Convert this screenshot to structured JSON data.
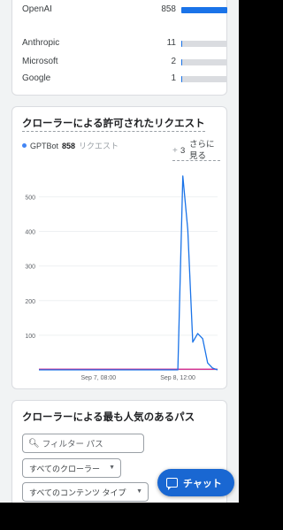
{
  "crawlers_table": {
    "rows": [
      {
        "name": "OpenAI",
        "count": "858",
        "fraction": 1.0
      },
      {
        "name": "Anthropic",
        "count": "11",
        "fraction": 0.013
      },
      {
        "name": "Microsoft",
        "count": "2",
        "fraction": 0.0
      },
      {
        "name": "Google",
        "count": "1",
        "fraction": 0.0
      }
    ]
  },
  "allowed_requests": {
    "title": "クローラーによる許可されたリクエスト",
    "legend": {
      "name": "GPTBot",
      "value": "858",
      "unit": "リクエスト"
    },
    "more": {
      "plus": "+",
      "count": "3",
      "label": "さらに見る"
    },
    "colors": {
      "primary": "#1a73e8",
      "secondary": "#d01884"
    }
  },
  "chart_data": {
    "type": "line",
    "y_ticks": [
      "500",
      "400",
      "300",
      "200",
      "100"
    ],
    "ylim": [
      0,
      570
    ],
    "x_ticks": [
      "Sep 7, 08:00",
      "Sep 8, 12:00"
    ],
    "x": [
      0,
      4,
      8,
      12,
      16,
      20,
      24,
      28,
      29,
      30,
      31,
      32,
      33,
      34,
      35,
      36
    ],
    "xlim": [
      0,
      36
    ],
    "x_tick_positions": [
      12,
      28
    ],
    "series": [
      {
        "name": "GPTBot",
        "color": "#1a73e8",
        "values": [
          0,
          0,
          0,
          0,
          0,
          0,
          0,
          0,
          560,
          405,
          80,
          105,
          90,
          20,
          5,
          0
        ]
      },
      {
        "color": "#d01884",
        "values": [
          2,
          2,
          2,
          2,
          2,
          2,
          2,
          2,
          2,
          2,
          2,
          2,
          2,
          2,
          2,
          2
        ]
      }
    ]
  },
  "popular_paths": {
    "title": "クローラーによる最も人気のあるパス",
    "search": {
      "icon": "search-icon",
      "placeholder": "フィルター パス"
    },
    "crawler_select": "すべてのクローラー",
    "content_select": "すべてのコンテンツ タイプ"
  },
  "chat_button": {
    "label": "チャット",
    "icon": "chat-icon"
  }
}
